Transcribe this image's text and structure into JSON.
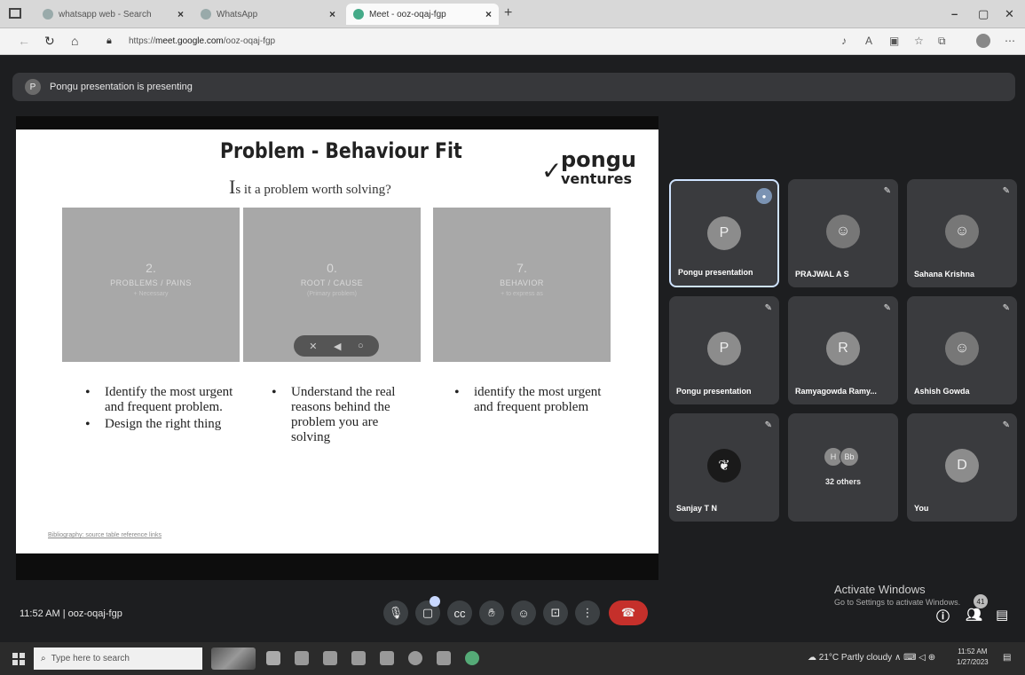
{
  "browser": {
    "tabs": [
      {
        "label": "whatsapp web - Search"
      },
      {
        "label": "WhatsApp"
      },
      {
        "label": "Meet - ooz-oqaj-fgp"
      }
    ],
    "url_domain": "meet.google.com",
    "url_prefix": "https://",
    "url_path": "/ooz-oqaj-fgp"
  },
  "banner": {
    "avatar_letter": "P",
    "text": "Pongu presentation is presenting"
  },
  "slide": {
    "title": "Problem - Behaviour Fit",
    "subtitle_cap": "I",
    "subtitle_rest": "s it a problem worth solving?",
    "logo_top": "pongu",
    "logo_bottom": "ventures",
    "boxes": [
      {
        "num": "2.",
        "label": "PROBLEMS / PAINS",
        "small": "+ Necessary"
      },
      {
        "num": "0.",
        "label": "ROOT / CAUSE",
        "small": "(Primary problem)"
      },
      {
        "num": "7.",
        "label": "BEHAVIOR",
        "small": "+ to express as"
      }
    ],
    "bullets_col1": [
      "Identify the most urgent and frequent problem.",
      "Design the right thing"
    ],
    "bullets_col2": [
      "Understand the real reasons behind the problem you are solving"
    ],
    "bullets_col3": [
      "identify the most urgent and frequent problem"
    ],
    "footnote": "Bibliography: source table reference links"
  },
  "participants": [
    {
      "name": "Pongu presentation",
      "initial": "P"
    },
    {
      "name": "PRAJWAL A S",
      "initial": ""
    },
    {
      "name": "Sahana Krishna",
      "initial": ""
    },
    {
      "name": "Pongu presentation",
      "initial": "P"
    },
    {
      "name": "Ramyagowda Ramy...",
      "initial": "R"
    },
    {
      "name": "Ashish Gowda",
      "initial": ""
    },
    {
      "name": "Sanjay T N",
      "initial": ""
    },
    {
      "name": "32 others",
      "initial": "",
      "mini": [
        "H",
        "Bb"
      ]
    },
    {
      "name": "You",
      "initial": "D"
    }
  ],
  "meeting": {
    "time": "11:52 AM",
    "separator": "|",
    "code": "ooz-oqaj-fgp",
    "participant_badge": "41"
  },
  "watermark": {
    "line1": "Activate Windows",
    "line2": "Go to Settings to activate Windows."
  },
  "taskbar": {
    "search_placeholder": "Type here to search",
    "weather": "21°C  Partly cloudy",
    "clock_time": "11:52 AM",
    "clock_date": "1/27/2023"
  },
  "colors": {
    "meet_bg": "#1d1e20",
    "tile_bg": "#3a3b3e",
    "hangup": "#c5302b",
    "box_grey": "#a8a8a8"
  }
}
